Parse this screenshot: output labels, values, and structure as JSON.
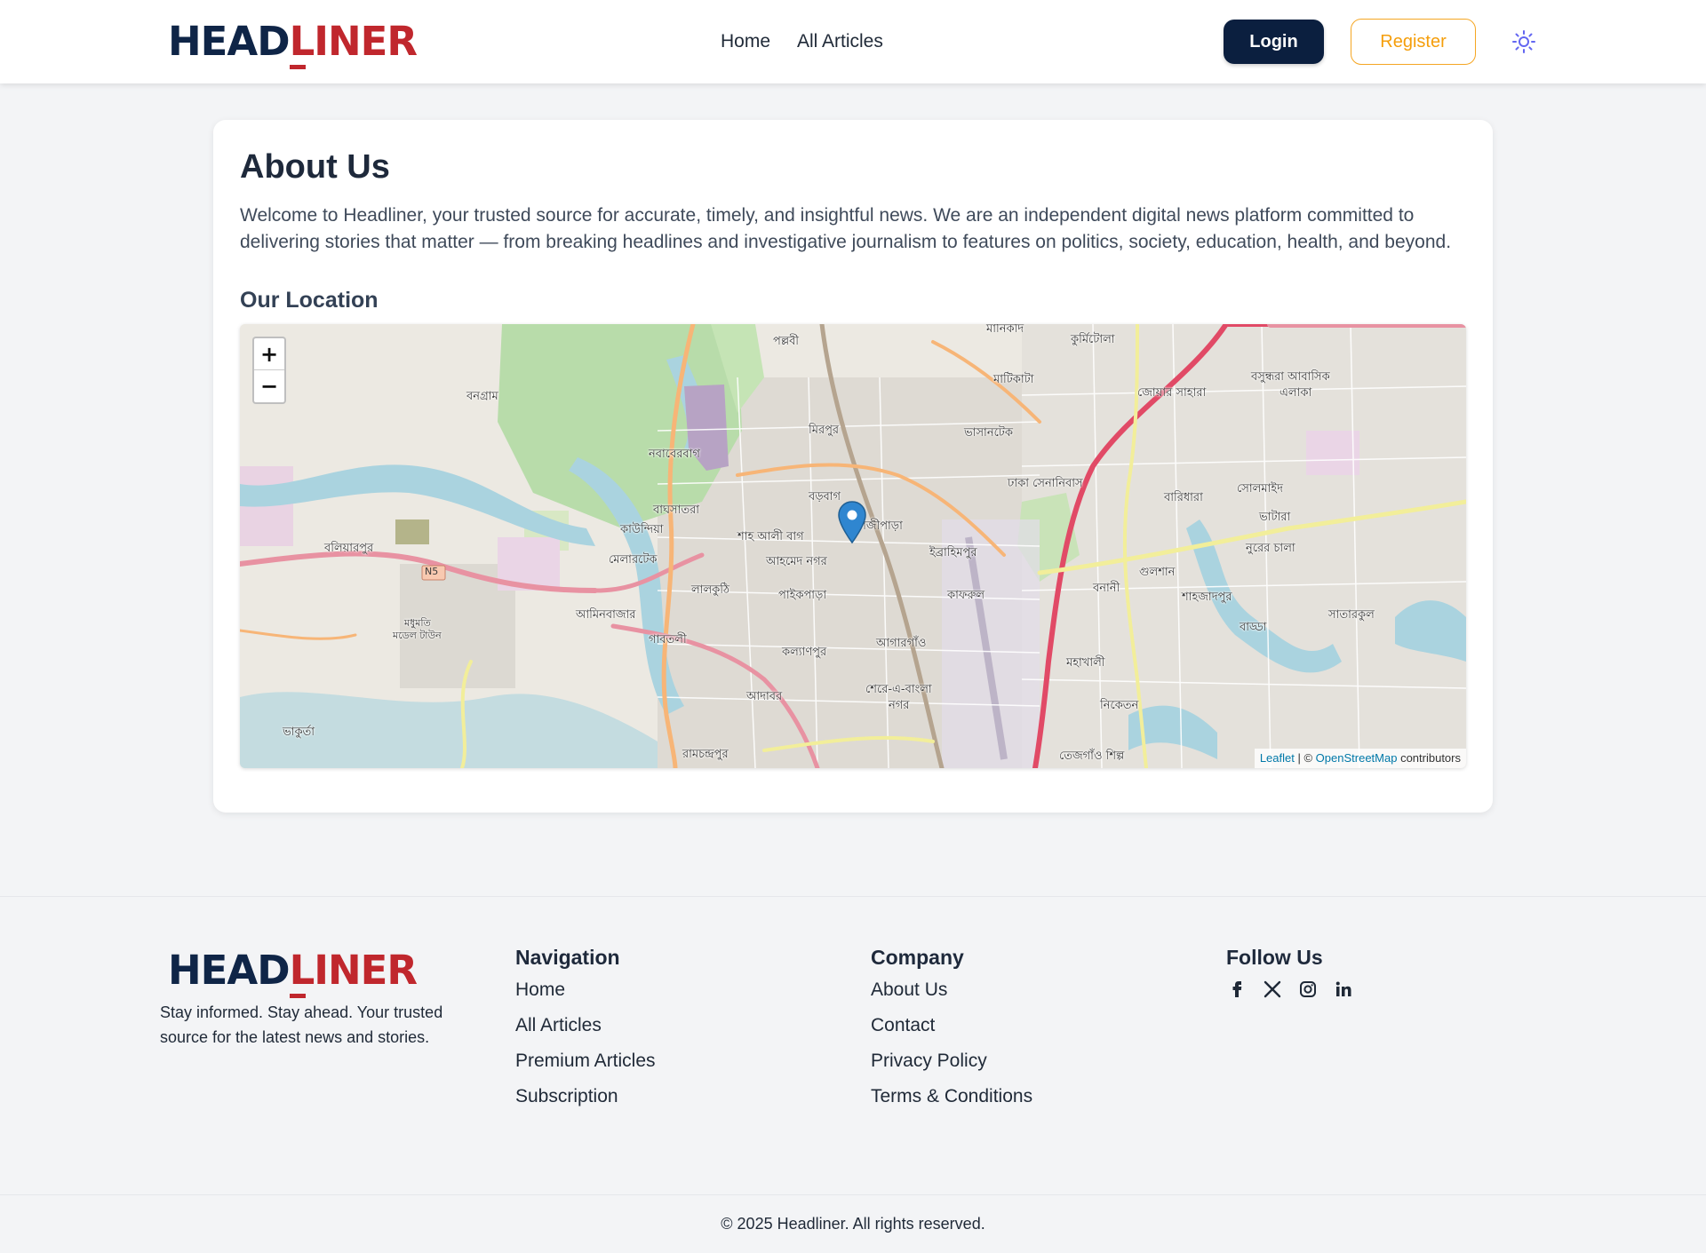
{
  "header": {
    "logo": {
      "part1": "HEAD",
      "part2": "LINER"
    },
    "nav": {
      "home": "Home",
      "all_articles": "All Articles"
    },
    "login_label": "Login",
    "register_label": "Register",
    "theme_icon": "sun-icon"
  },
  "main": {
    "title": "About Us",
    "description": "Welcome to Headliner, your trusted source for accurate, timely, and insightful news. We are an independent digital news platform committed to delivering stories that matter — from breaking headlines and investigative journalism to features on politics, society, education, health, and beyond.",
    "location_title": "Our Location"
  },
  "map": {
    "zoom_in": "+",
    "zoom_out": "−",
    "marker_icon": "map-pin-icon",
    "labels": {
      "pallabi": "পল্লবী",
      "mirpur": "মিরপুর",
      "banagram": "বনগ্রাম",
      "nababerbag": "নবাবেরবাগ",
      "boroibag": "বড়বাগ",
      "kazipara": "কাজীপাড়া",
      "bashabari": "বাঘসাতরা",
      "kaundia": "কাউন্দিয়া",
      "shah_ali": "শাহ আলী বাগ",
      "ahmed_nagar": "আহমেদ নগর",
      "melartek": "মেলারটেক",
      "lalkuthi": "লালকুঠি",
      "paikpara": "পাইকপাড়া",
      "aminbazar": "আমিনবাজার",
      "gabtali": "গাবতলী",
      "kalyanpur": "কল্যাণপুর",
      "agargaon": "আগারগাঁও",
      "adabor": "আদাবর",
      "sher_e_bangla": "শেরে-এ-বাংলা",
      "nagar": "নগর",
      "ramchandrapur": "রামচন্দ্রপুর",
      "baliarpur": "বলিয়ারপুর",
      "bhakurta": "ভাকুর্তা",
      "madhumati": "মধুমতি",
      "model_town": "মডেল টাউন",
      "manikdi": "মানিকদি",
      "kurmitola": "কুর্মিটোলা",
      "matikata": "মাটিকাটা",
      "bhashantek": "ভাসানটেক",
      "dhaka_cantonment": "ঢাকা সেনানিবাস",
      "ibrahimpur": "ইব্রাহিমপুর",
      "kafrul": "কাফরুল",
      "mohakhali": "মহাখালী",
      "niketon": "নিকেতন",
      "tejgaon": "তেজগাঁও শিল্প",
      "joar_sahara": "জোয়ার সাহারা",
      "bashundhara": "বসুন্ধরা আবাসিক",
      "elaka": "এলাকা",
      "baridhara": "বারিধারা",
      "solmaid": "সোলমাইদ",
      "bhatara": "ভাটারা",
      "nurer_chala": "নুরের চালা",
      "gulshan": "গুলশান",
      "banani": "বনানী",
      "shahjadpur": "শাহজাদপুর",
      "badda": "বাড্ডা",
      "satarkul": "সাতারকুল",
      "n5": "N5"
    },
    "attribution": {
      "leaflet": "Leaflet",
      "separator": " | © ",
      "osm": "OpenStreetMap",
      "suffix": " contributors"
    }
  },
  "footer": {
    "logo": {
      "part1": "HEAD",
      "part2": "LINER"
    },
    "tagline": "Stay informed. Stay ahead. Your trusted source for the latest news and stories.",
    "navigation": {
      "title": "Navigation",
      "links": [
        "Home",
        "All Articles",
        "Premium Articles",
        "Subscription"
      ]
    },
    "company": {
      "title": "Company",
      "links": [
        "About Us",
        "Contact",
        "Privacy Policy",
        "Terms & Conditions"
      ]
    },
    "follow": {
      "title": "Follow Us",
      "icons": [
        "facebook-icon",
        "x-icon",
        "instagram-icon",
        "linkedin-icon"
      ]
    },
    "copyright": "© 2025 Headliner. All rights reserved."
  },
  "colors": {
    "brand_dark": "#0f2547",
    "brand_red": "#c0272d",
    "register_accent": "#f59e0b",
    "login_bg": "#0b1f3f",
    "theme_icon": "#6366f1"
  }
}
